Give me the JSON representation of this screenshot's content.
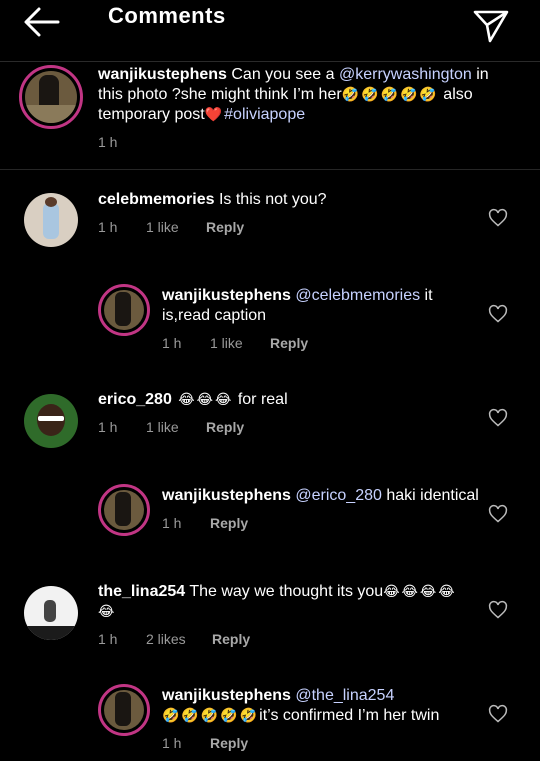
{
  "header": {
    "title": "Comments"
  },
  "caption": {
    "user": "wanjikustephens",
    "text1": " Can you see a ",
    "mention": "@kerrywashington",
    "text2": "  in this photo ?she might think I’m her",
    "emojis1": "🤣🤣🤣🤣🤣",
    "text3": " also temporary post",
    "heart": "❤️",
    "hashtag": "#oliviapope",
    "time": "1 h"
  },
  "comments": [
    {
      "user": "celebmemories",
      "text": " Is this not you?",
      "time": "1 h",
      "likes": "1 like",
      "reply": "Reply"
    },
    {
      "user": "wanjikustephens",
      "mention": " @celebmemories",
      "text": " it is,read caption",
      "time": "1 h",
      "likes": "1 like",
      "reply": "Reply"
    },
    {
      "user": "erico_280",
      "emojis": " 😂😂😂",
      "text": "  for real",
      "time": "1 h",
      "likes": "1 like",
      "reply": "Reply"
    },
    {
      "user": "wanjikustephens",
      "mention": " @erico_280",
      "text": " haki identical",
      "time": "1 h",
      "reply": "Reply"
    },
    {
      "user": "the_lina254",
      "text": " The way we thought its you",
      "emojis": "😂😂😂😂😂",
      "time": "1 h",
      "likes": "2 likes",
      "reply": "Reply"
    },
    {
      "user": "wanjikustephens",
      "mention": " @the_lina254",
      "emojis": "🤣🤣🤣🤣🤣",
      "text": "it’s confirmed I’m her twin",
      "time": "1 h",
      "reply": "Reply"
    }
  ],
  "colors": {
    "ring": "#c13584",
    "mention": "#c7d2ff",
    "muted": "#9a9a9a"
  },
  "icons": [
    "back-arrow-icon",
    "send-icon",
    "heart-icon"
  ]
}
